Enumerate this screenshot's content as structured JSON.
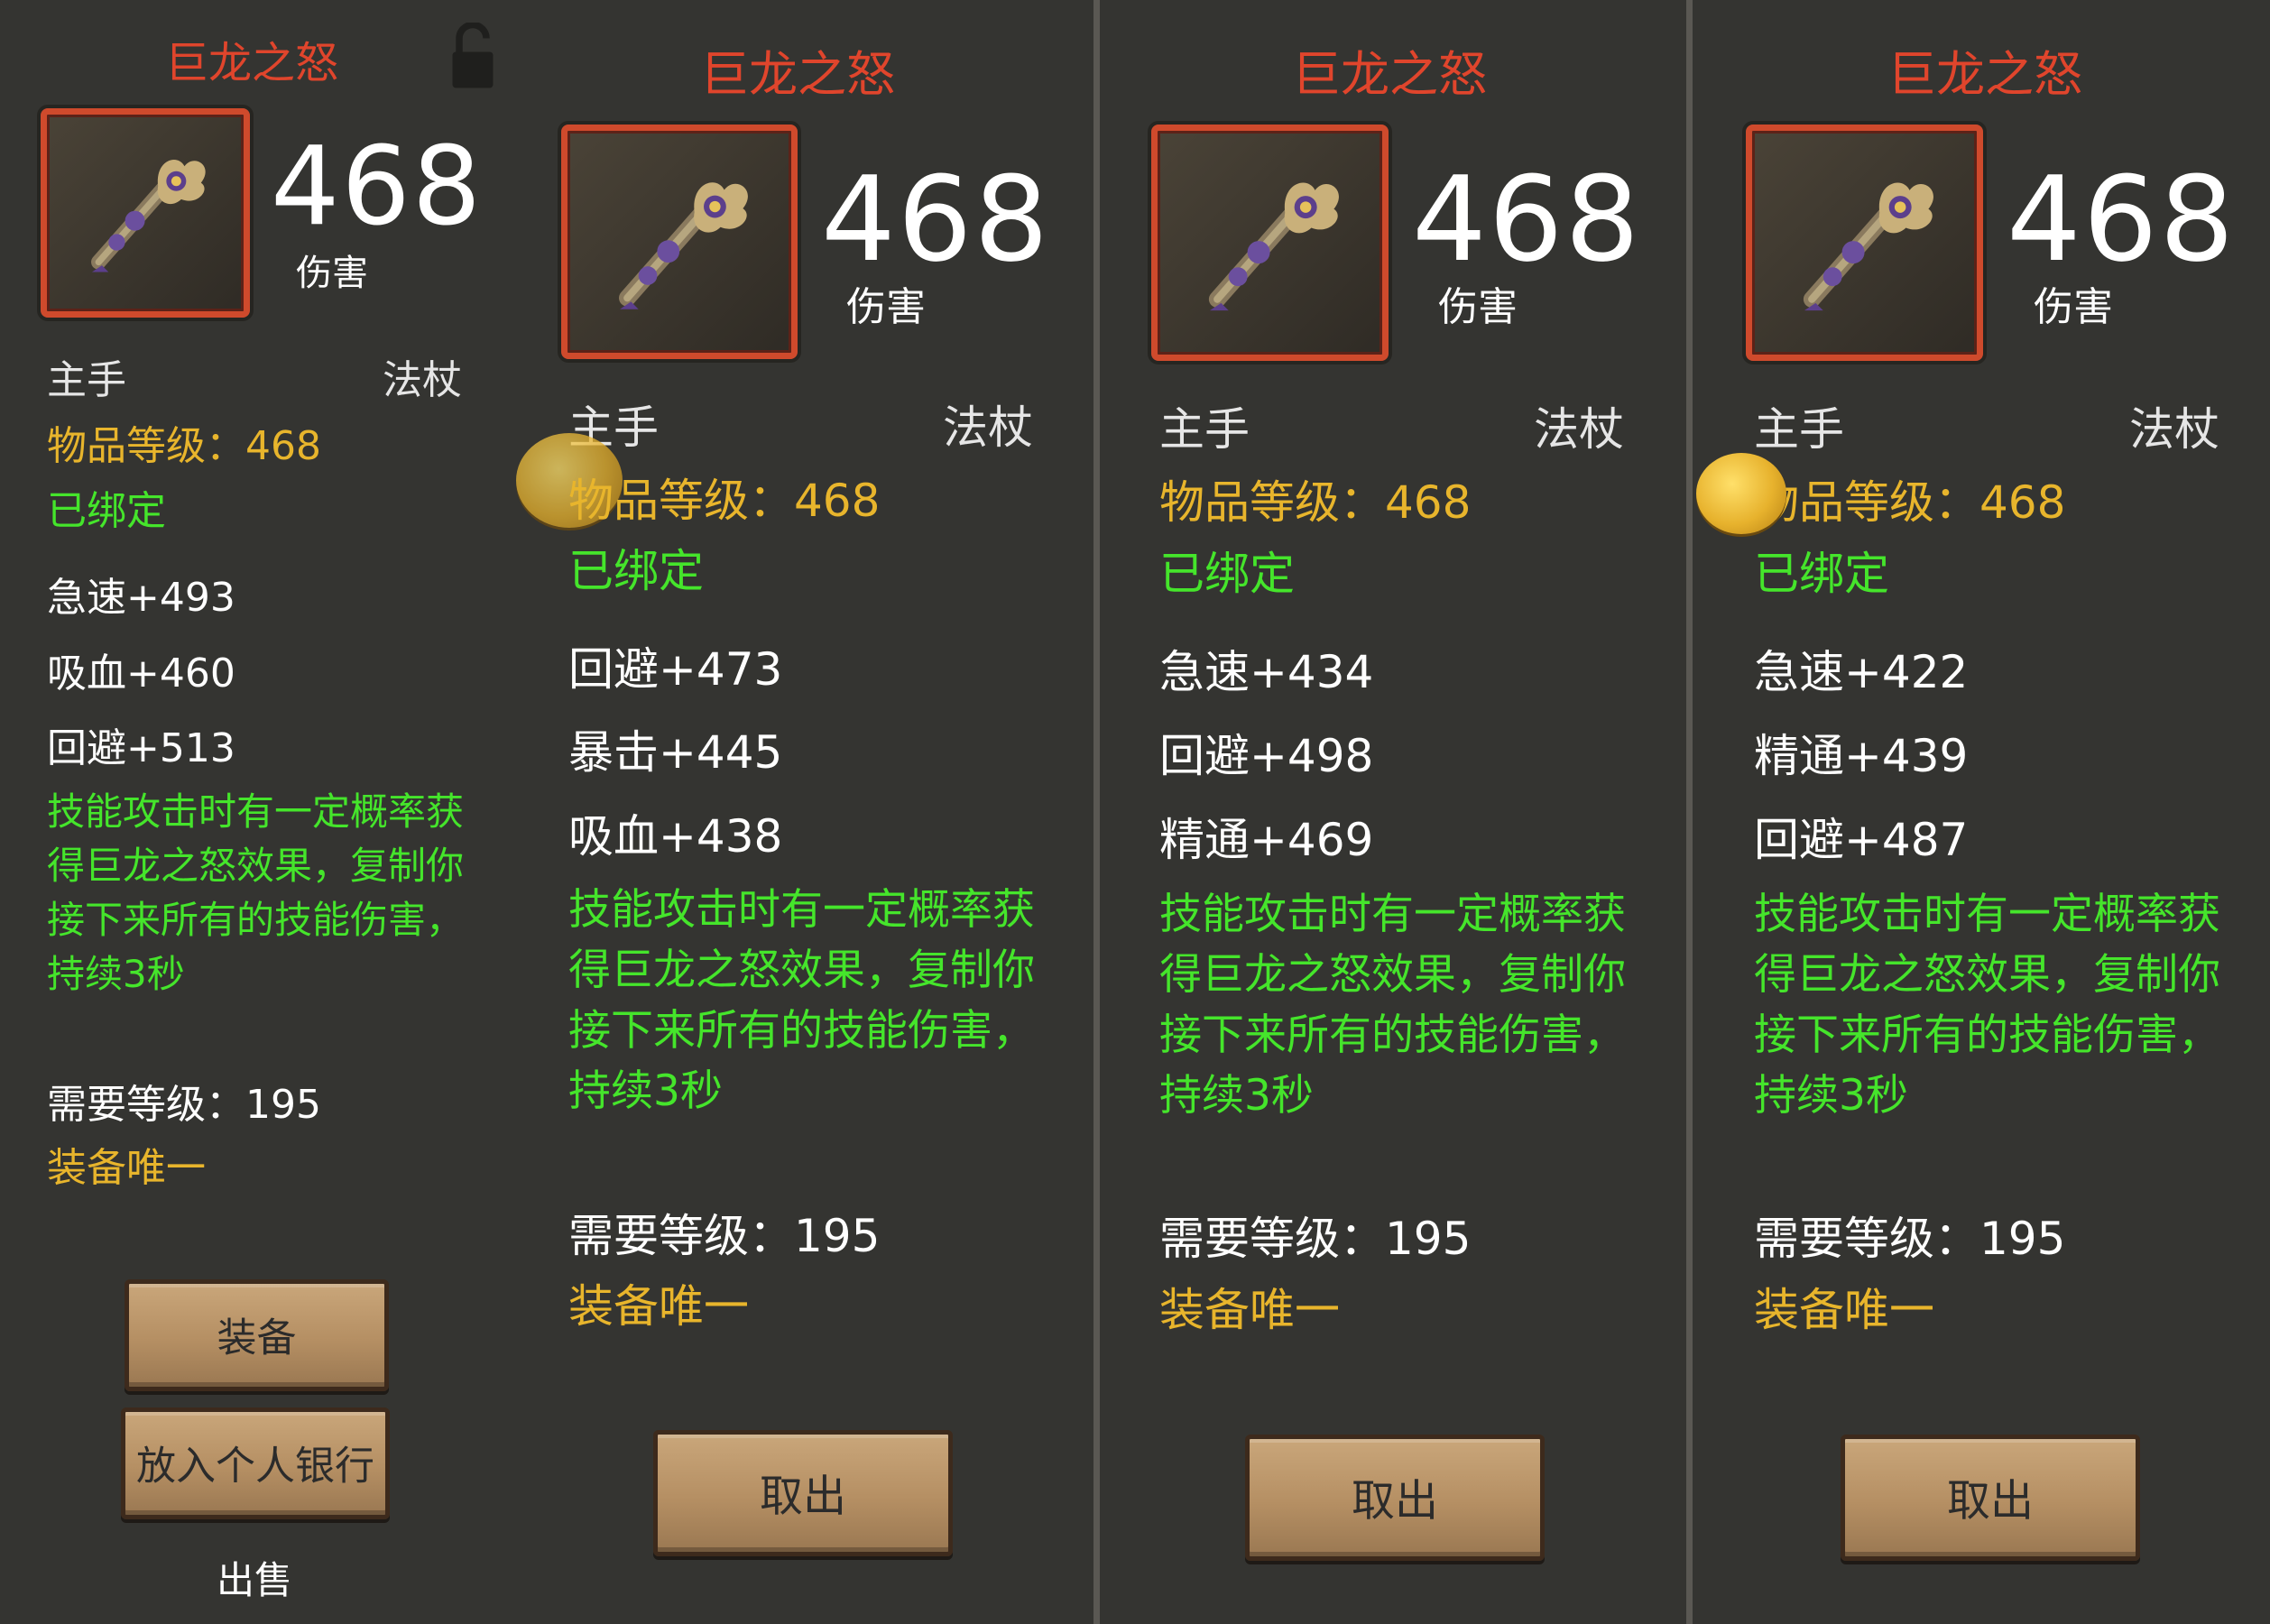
{
  "panels": [
    {
      "title": "巨龙之怒",
      "damage_value": "468",
      "damage_label": "伤害",
      "slot": "主手",
      "weapon_type": "法杖",
      "item_level": "物品等级：468",
      "bound": "已绑定",
      "stats": [
        "急速+493",
        "吸血+460",
        "回避+513"
      ],
      "effect": "技能攻击时有一定概率获得巨龙之怒效果，复制你接下来所有的技能伤害，持续3秒",
      "required_level": "需要等级：195",
      "unique": "装备唯一",
      "buttons": [
        "装备",
        "放入个人银行"
      ],
      "sell": "出售"
    },
    {
      "title": "巨龙之怒",
      "damage_value": "468",
      "damage_label": "伤害",
      "slot": "主手",
      "weapon_type": "法杖",
      "item_level": "物品等级：468",
      "bound": "已绑定",
      "stats": [
        "回避+473",
        "暴击+445",
        "吸血+438"
      ],
      "effect": "技能攻击时有一定概率获得巨龙之怒效果，复制你接下来所有的技能伤害，持续3秒",
      "required_level": "需要等级：195",
      "unique": "装备唯一",
      "buttons": [
        "取出"
      ]
    },
    {
      "title": "巨龙之怒",
      "damage_value": "468",
      "damage_label": "伤害",
      "slot": "主手",
      "weapon_type": "法杖",
      "item_level": "物品等级：468",
      "bound": "已绑定",
      "stats": [
        "急速+434",
        "回避+498",
        "精通+469"
      ],
      "effect": "技能攻击时有一定概率获得巨龙之怒效果，复制你接下来所有的技能伤害，持续3秒",
      "required_level": "需要等级：195",
      "unique": "装备唯一",
      "buttons": [
        "取出"
      ]
    },
    {
      "title": "巨龙之怒",
      "damage_value": "468",
      "damage_label": "伤害",
      "slot": "主手",
      "weapon_type": "法杖",
      "item_level": "物品等级：468",
      "bound": "已绑定",
      "stats": [
        "急速+422",
        "精通+439",
        "回避+487"
      ],
      "effect": "技能攻击时有一定概率获得巨龙之怒效果，复制你接下来所有的技能伤害，持续3秒",
      "required_level": "需要等级：195",
      "unique": "装备唯一",
      "buttons": [
        "取出"
      ]
    }
  ],
  "icons": {
    "item": "staff-icon",
    "lock": "lock-icon",
    "coin": "coin-icon"
  },
  "colors": {
    "background": "#343431",
    "title": "#e0452c",
    "item_level": "#e8b52c",
    "bound": "#45e52b",
    "effect": "#45e52b",
    "unique": "#e8b52c",
    "frame": "#cf4a2c",
    "button_wood": "#b58f63"
  }
}
